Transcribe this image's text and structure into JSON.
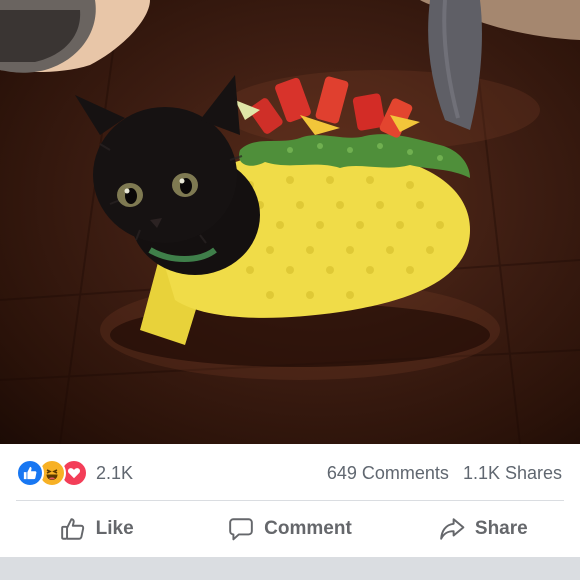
{
  "post": {
    "photo_alt": "",
    "reaction_icons": [
      "like-reaction-icon",
      "haha-reaction-icon",
      "love-reaction-icon"
    ],
    "reaction_count": "2.1K",
    "comments_label": "649 Comments",
    "shares_label": "1.1K Shares"
  },
  "actions": {
    "like_label": "Like",
    "comment_label": "Comment",
    "share_label": "Share"
  },
  "colors": {
    "like_blue": "#1877f2",
    "haha_yellow": "#f7b125",
    "love_red": "#f33e58",
    "text_gray": "#606770",
    "divider": "#dadde1"
  }
}
